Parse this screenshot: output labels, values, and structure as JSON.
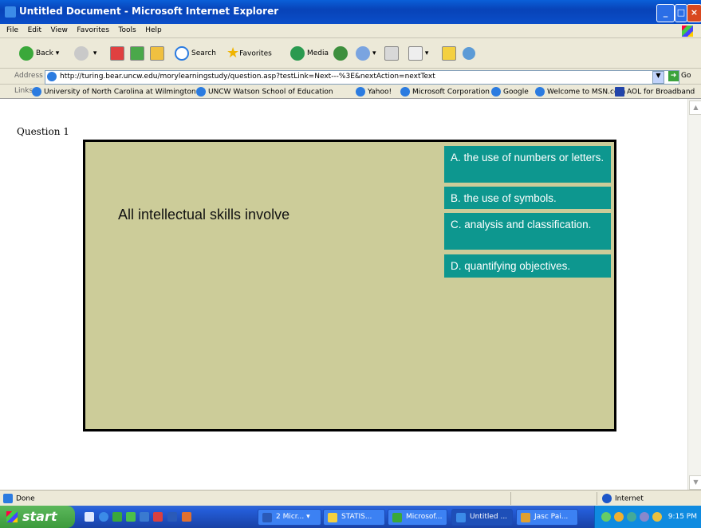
{
  "window": {
    "title": "Untitled Document - Microsoft Internet Explorer"
  },
  "menu": [
    "File",
    "Edit",
    "View",
    "Favorites",
    "Tools",
    "Help"
  ],
  "toolbar": {
    "back": "Back",
    "search": "Search",
    "favorites": "Favorites",
    "media": "Media"
  },
  "address": {
    "label": "Address",
    "url": "http://turing.bear.uncw.edu/morylearningstudy/question.asp?testLink=Next---%3E&nextAction=nextText",
    "go": "Go"
  },
  "links": {
    "label": "Links",
    "items": [
      "University of North Carolina at Wilmington",
      "UNCW Watson School of Education",
      "Yahoo!",
      "Microsoft Corporation",
      "Google",
      "Welcome to MSN.com",
      "AOL for Broadband"
    ]
  },
  "page": {
    "question_number": "Question 1",
    "stem": "All intellectual skills involve",
    "choices": [
      "A. the use of numbers or letters.",
      "B. the use of symbols.",
      "C. analysis and classification.",
      "D. quantifying objectives."
    ]
  },
  "status": {
    "text": "Done",
    "zone": "Internet"
  },
  "taskbar": {
    "start": "start",
    "tasks": [
      "2 Micr...",
      "STATIS...",
      "Microsof...",
      "Untitled ...",
      "Jasc Pai..."
    ],
    "clock": "9:15 PM"
  }
}
